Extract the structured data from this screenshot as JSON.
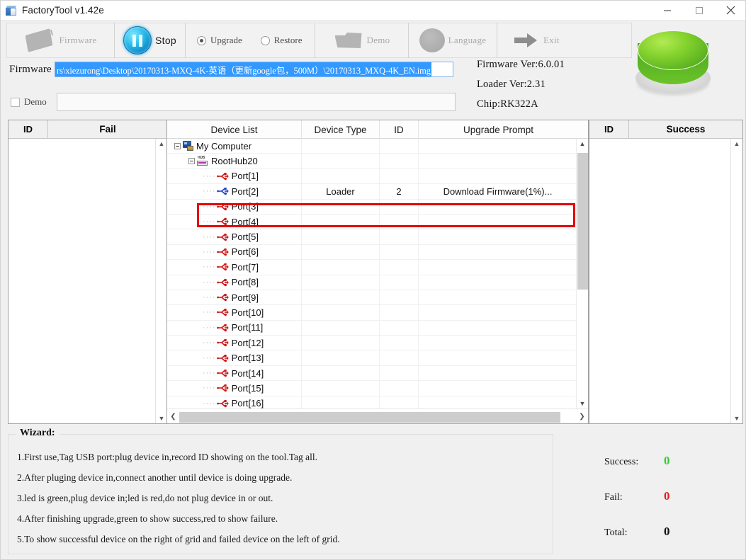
{
  "window": {
    "title": "FactoryTool v1.42e",
    "minimize_label": "Minimize",
    "maximize_label": "Maximize",
    "close_label": "Close"
  },
  "toolbar": {
    "firmware_label": "Firmware",
    "stop_label": "Stop",
    "upgrade_label": "Upgrade",
    "restore_label": "Restore",
    "demo_label": "Demo",
    "language_label": "Language",
    "exit_label": "Exit",
    "mode_selected": "Upgrade"
  },
  "firmware": {
    "label": "Firmware",
    "path": "rs\\xiezurong\\Desktop\\20170313-MXQ-4K-英语（更新google包，500M）\\20170313_MXQ-4K_EN.img",
    "selected": true
  },
  "demo": {
    "checkbox_label": "Demo",
    "checked": false,
    "value": ""
  },
  "info": {
    "firmware_ver": "Firmware Ver:6.0.01",
    "loader_ver": "Loader Ver:2.31",
    "chip": "Chip:RK322A"
  },
  "led": {
    "state": "green",
    "color": "#6cc32a"
  },
  "fail_panel": {
    "columns": [
      "ID",
      "Fail"
    ],
    "rows": []
  },
  "success_panel": {
    "columns": [
      "ID",
      "Success"
    ],
    "rows": []
  },
  "device_grid": {
    "columns": [
      "Device List",
      "Device Type",
      "ID",
      "Upgrade Prompt"
    ],
    "rows": [
      {
        "indent": 0,
        "icon": "computer-icon",
        "expander": "minus",
        "name": "My Computer",
        "type": "",
        "id": "",
        "prompt": ""
      },
      {
        "indent": 1,
        "icon": "hub-icon",
        "expander": "minus",
        "name": "RootHub20",
        "type": "",
        "id": "",
        "prompt": ""
      },
      {
        "indent": 2,
        "icon": "usb-icon-red",
        "expander": "none",
        "name": "Port[1]",
        "type": "",
        "id": "",
        "prompt": ""
      },
      {
        "indent": 2,
        "icon": "usb-icon-blue",
        "expander": "none",
        "name": "Port[2]",
        "type": "Loader",
        "id": "2",
        "prompt": "Download Firmware(1%)..."
      },
      {
        "indent": 2,
        "icon": "usb-icon-red",
        "expander": "none",
        "name": "Port[3]",
        "type": "",
        "id": "",
        "prompt": ""
      },
      {
        "indent": 2,
        "icon": "usb-icon-red",
        "expander": "none",
        "name": "Port[4]",
        "type": "",
        "id": "",
        "prompt": ""
      },
      {
        "indent": 2,
        "icon": "usb-icon-red",
        "expander": "none",
        "name": "Port[5]",
        "type": "",
        "id": "",
        "prompt": ""
      },
      {
        "indent": 2,
        "icon": "usb-icon-red",
        "expander": "none",
        "name": "Port[6]",
        "type": "",
        "id": "",
        "prompt": ""
      },
      {
        "indent": 2,
        "icon": "usb-icon-red",
        "expander": "none",
        "name": "Port[7]",
        "type": "",
        "id": "",
        "prompt": ""
      },
      {
        "indent": 2,
        "icon": "usb-icon-red",
        "expander": "none",
        "name": "Port[8]",
        "type": "",
        "id": "",
        "prompt": ""
      },
      {
        "indent": 2,
        "icon": "usb-icon-red",
        "expander": "none",
        "name": "Port[9]",
        "type": "",
        "id": "",
        "prompt": ""
      },
      {
        "indent": 2,
        "icon": "usb-icon-red",
        "expander": "none",
        "name": "Port[10]",
        "type": "",
        "id": "",
        "prompt": ""
      },
      {
        "indent": 2,
        "icon": "usb-icon-red",
        "expander": "none",
        "name": "Port[11]",
        "type": "",
        "id": "",
        "prompt": ""
      },
      {
        "indent": 2,
        "icon": "usb-icon-red",
        "expander": "none",
        "name": "Port[12]",
        "type": "",
        "id": "",
        "prompt": ""
      },
      {
        "indent": 2,
        "icon": "usb-icon-red",
        "expander": "none",
        "name": "Port[13]",
        "type": "",
        "id": "",
        "prompt": ""
      },
      {
        "indent": 2,
        "icon": "usb-icon-red",
        "expander": "none",
        "name": "Port[14]",
        "type": "",
        "id": "",
        "prompt": ""
      },
      {
        "indent": 2,
        "icon": "usb-icon-red",
        "expander": "none",
        "name": "Port[15]",
        "type": "",
        "id": "",
        "prompt": ""
      },
      {
        "indent": 2,
        "icon": "usb-icon-red",
        "expander": "none",
        "name": "Port[16]",
        "type": "",
        "id": "",
        "prompt": ""
      }
    ],
    "highlighted_row_index": 3,
    "highlight_color": "#e60000"
  },
  "wizard": {
    "title": "Wizard:",
    "items": [
      "1.First use,Tag USB port:plug device in,record ID showing on the tool.Tag all.",
      "2.After pluging device in,connect another until device is doing upgrade.",
      "3.led is green,plug device in;led is red,do not plug device in or out.",
      "4.After finishing upgrade,green to show success,red to show failure.",
      "5.To show successful device on the right of grid and failed device on the left of grid."
    ]
  },
  "counters": {
    "success_label": "Success:",
    "success_value": "0",
    "success_color": "#33cc33",
    "fail_label": "Fail:",
    "fail_value": "0",
    "fail_color": "#e02020",
    "total_label": "Total:",
    "total_value": "0",
    "total_color": "#111111"
  }
}
